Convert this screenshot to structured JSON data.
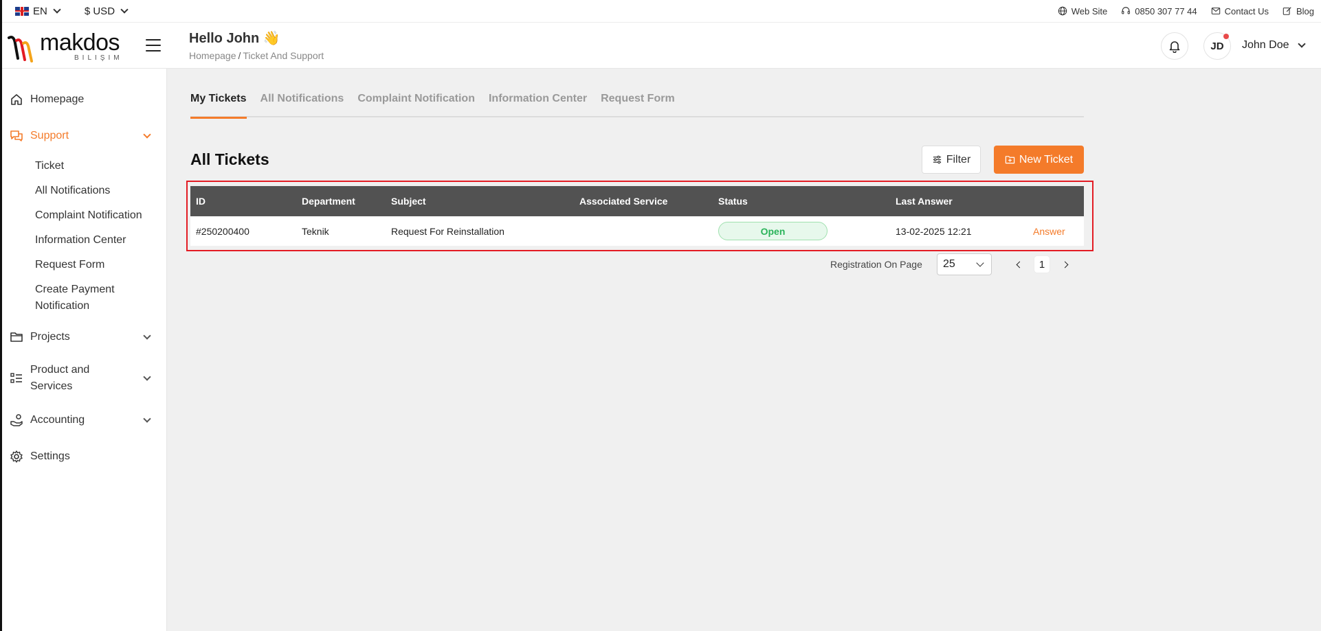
{
  "topbar": {
    "language": "EN",
    "currency": "$ USD",
    "links": {
      "website": "Web Site",
      "phone": "0850 307 77 44",
      "contact": "Contact Us",
      "blog": "Blog"
    }
  },
  "header": {
    "logo_text": "makdos",
    "logo_sub": "BILIŞIM",
    "greeting": "Hello John 👋",
    "breadcrumb": {
      "home": "Homepage",
      "separator": "/",
      "current": "Ticket And Support"
    },
    "avatar_initials": "JD",
    "user_name": "John Doe"
  },
  "sidebar": {
    "items": [
      {
        "label": "Homepage",
        "icon": "home-icon"
      },
      {
        "label": "Support",
        "icon": "chat-icon",
        "active": true
      },
      {
        "label": "Projects",
        "icon": "folder-icon"
      },
      {
        "label": "Product and Services",
        "icon": "list-icon"
      },
      {
        "label": "Accounting",
        "icon": "money-hand-icon"
      },
      {
        "label": "Settings",
        "icon": "gear-icon"
      }
    ],
    "support_sub": [
      "Ticket",
      "All Notifications",
      "Complaint Notification",
      "Information Center",
      "Request Form",
      "Create Payment Notification"
    ]
  },
  "tabs": [
    "My Tickets",
    "All Notifications",
    "Complaint Notification",
    "Information Center",
    "Request Form"
  ],
  "main": {
    "title": "All Tickets",
    "filter_label": "Filter",
    "new_ticket_label": "New Ticket"
  },
  "table": {
    "headers": [
      "ID",
      "Department",
      "Subject",
      "Associated Service",
      "Status",
      "Last Answer"
    ],
    "rows": [
      {
        "id": "#250200400",
        "department": "Teknik",
        "subject": "Request For Reinstallation",
        "service": "",
        "status": "Open",
        "last_answer": "13-02-2025 12:21",
        "action": "Answer"
      }
    ]
  },
  "pagination": {
    "label": "Registration On Page",
    "per_page": "25",
    "current_page": "1"
  },
  "colors": {
    "accent": "#f47b2a",
    "table_header": "#525252",
    "status_open": "#2bb35a",
    "highlight": "#e31b23"
  }
}
